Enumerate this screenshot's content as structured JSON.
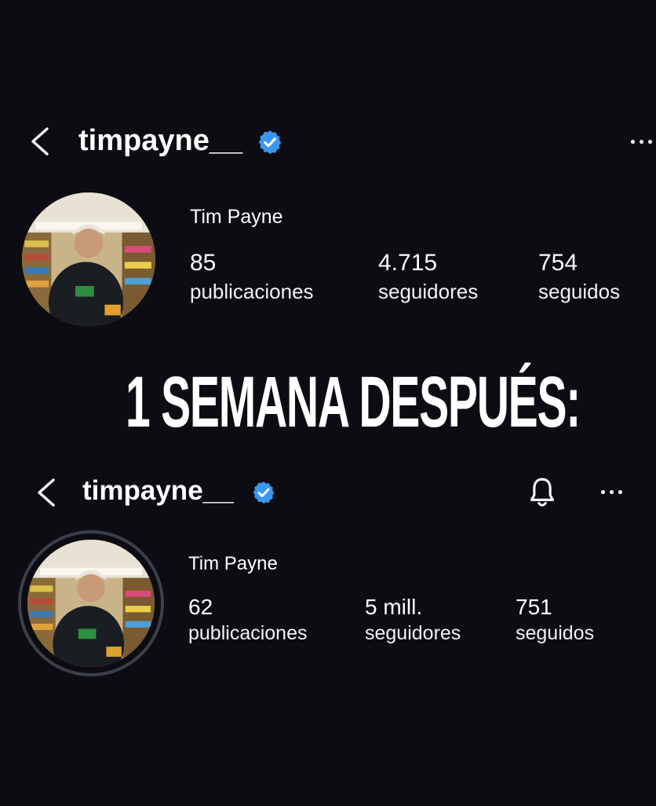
{
  "profile_before": {
    "username": "timpayne__",
    "full_name": "Tim Payne",
    "verified": true,
    "stats": [
      {
        "value": "85",
        "label": "publicaciones"
      },
      {
        "value": "4.715",
        "label": "seguidores"
      },
      {
        "value": "754",
        "label": "seguidos"
      }
    ]
  },
  "banner": {
    "text": "1 SEMANA DESPUÉS:"
  },
  "profile_after": {
    "username": "timpayne__",
    "full_name": "Tim Payne",
    "verified": true,
    "stats": [
      {
        "value": "62",
        "label": "publicaciones"
      },
      {
        "value": "5 mill.",
        "label": "seguidores"
      },
      {
        "value": "751",
        "label": "seguidos"
      }
    ]
  },
  "colors": {
    "background": "#0c0c12",
    "verified_badge": "#3897f0",
    "text": "#ffffff",
    "avatar_ring": "#3a3f4a"
  },
  "icons": [
    "back-icon",
    "verified-icon",
    "more-icon",
    "bell-icon"
  ]
}
